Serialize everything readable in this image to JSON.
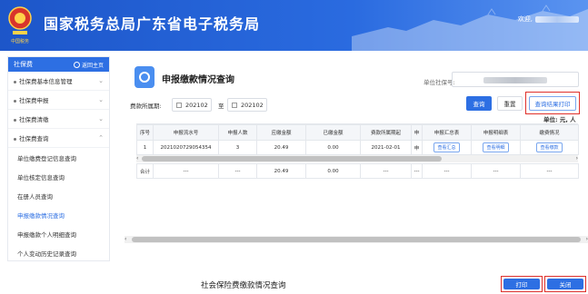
{
  "header": {
    "title": "国家税务总局广东省电子税务局",
    "logo_text": "中国税务",
    "welcome": "欢迎,"
  },
  "sidebar": {
    "title": "社保费",
    "home_label": "返回主页",
    "groups": [
      {
        "label": "社保费基本信息管理",
        "expanded": false
      },
      {
        "label": "社保费申报",
        "expanded": false
      },
      {
        "label": "社保费清缴",
        "expanded": false
      },
      {
        "label": "社保费查询",
        "expanded": true
      }
    ],
    "subitems": [
      {
        "label": "单位缴费登记信息查询",
        "active": false
      },
      {
        "label": "单位核定信息查询",
        "active": false
      },
      {
        "label": "在册人员查询",
        "active": false
      },
      {
        "label": "申报缴款情况查询",
        "active": true
      },
      {
        "label": "申报缴款个人明细查询",
        "active": false
      },
      {
        "label": "个人变动历史记录查询",
        "active": false
      }
    ]
  },
  "main": {
    "page_title": "申报缴款情况查询",
    "unit_social_label": "单位社保号:",
    "period_label": "费款所属期:",
    "period_from": "202102",
    "period_separator": "至",
    "period_to": "202102",
    "query_button": "查询",
    "reset_button": "重置",
    "print_result_button": "查询结果打印",
    "currency_note": "单位: 元, 人",
    "table": {
      "headers": [
        "序号",
        "申报流水号",
        "申报人数",
        "应缴金额",
        "已缴金额",
        "费款所属期起",
        "申",
        "申报汇总表",
        "申报明细表",
        "缴费情况"
      ],
      "rows": [
        [
          "1",
          "2021020729054354",
          "3",
          "20.49",
          "0.00",
          "2021-02-01",
          "申",
          "查看汇总",
          "查看明细",
          "查看缴款"
        ]
      ],
      "total": [
        "合计",
        "---",
        "---",
        "20.49",
        "0.00",
        "---",
        "---",
        "---",
        "---",
        "---"
      ]
    }
  },
  "footer": {
    "title": "社会保险费缴款情况查询",
    "print_button": "打印",
    "close_button": "关闭"
  },
  "colors": {
    "primary": "#2d6fe3",
    "highlight_frame": "#e0312b"
  }
}
